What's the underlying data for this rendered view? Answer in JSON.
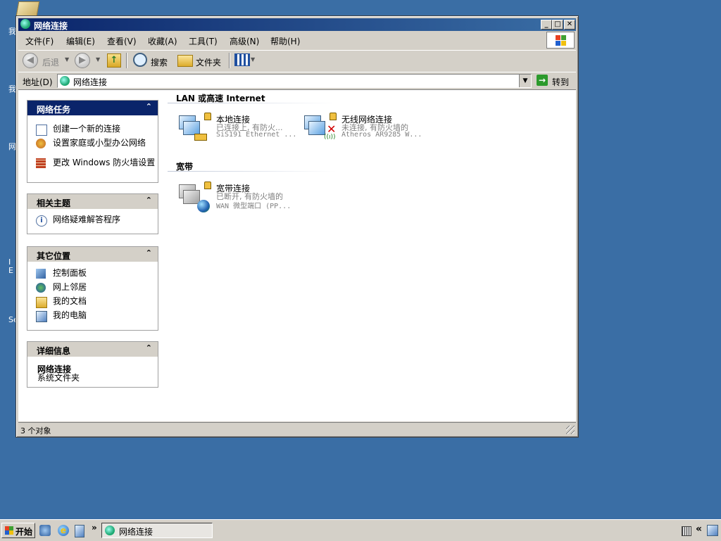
{
  "desktop": {
    "fragments": [
      "我",
      "我",
      "网",
      "I",
      "E",
      "Se"
    ]
  },
  "window": {
    "title": "网络连接",
    "controls": {
      "minimize": "_",
      "maximize": "□",
      "close": "✕"
    }
  },
  "menu": {
    "items": [
      "文件(F)",
      "编辑(E)",
      "查看(V)",
      "收藏(A)",
      "工具(T)",
      "高级(N)",
      "帮助(H)"
    ]
  },
  "toolbar": {
    "back_label": "后退",
    "search_label": "搜索",
    "folders_label": "文件夹"
  },
  "address": {
    "label": "地址(D)",
    "value": "网络连接",
    "go_label": "转到"
  },
  "sidebar": {
    "network_tasks": {
      "title": "网络任务",
      "items": [
        "创建一个新的连接",
        "设置家庭或小型办公网络",
        "更改 Windows 防火墙设置"
      ]
    },
    "see_also": {
      "title": "相关主题",
      "items": [
        "网络疑难解答程序"
      ]
    },
    "other_places": {
      "title": "其它位置",
      "items": [
        "控制面板",
        "网上邻居",
        "我的文档",
        "我的电脑"
      ]
    },
    "details": {
      "title": "详细信息",
      "name": "网络连接",
      "type": "系统文件夹"
    }
  },
  "groups": {
    "lan": {
      "title": "LAN 或高速 Internet",
      "connections": [
        {
          "name": "本地连接",
          "status": "已连接上, 有防火...",
          "device": "SiS191 Ethernet ..."
        },
        {
          "name": "无线网络连接",
          "status": "未连接, 有防火墙的",
          "device": "Atheros AR9285 W..."
        }
      ]
    },
    "broadband": {
      "title": "宽带",
      "connections": [
        {
          "name": "宽带连接",
          "status": "已断开, 有防火墙的",
          "device": "WAN 微型端口 (PP..."
        }
      ]
    }
  },
  "status": {
    "text": "3 个对象"
  },
  "taskbar": {
    "start_label": "开始",
    "chevron": "»",
    "task_label": "网络连接",
    "tray_chevron": "«"
  }
}
